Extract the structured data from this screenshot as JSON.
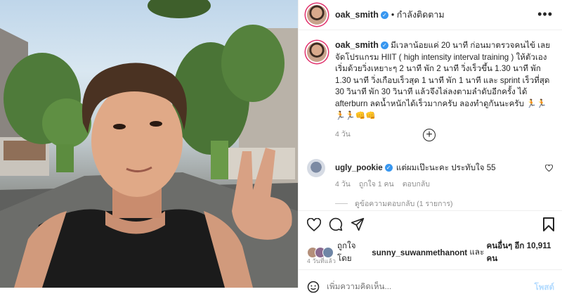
{
  "post": {
    "username": "oak_smith",
    "follow_state": "• กำลังติดตาม",
    "caption": "มีเวลาน้อยแค่ 20 นาที ก่อนมาตรวจคนไข้ เลยจัดโปรแกรม HIIT ( high intensity interval training ) ให้ตัวเอง เริ่มด้วยวิ่งเหยาะๆ 2 นาที พัก 2 นาที วิ่งเร็วขึ้น 1.30 นาที พัก 1.30 นาที วิ่งเกือบเร็วสุด 1 นาที พัก 1 นาที และ sprint เร็วที่สุด 30 วินาที พัก 30 วินาที แล้วจึงไล่ลงตามลำดับอีกครั้ง ได้ afterburn ลดน้ำหนักได้เร็วมากครับ ลองทำดูกันนะครับ 🏃🏃🏃🏃👊👊",
    "caption_age": "4 วัน"
  },
  "comment": {
    "username": "ugly_pookie",
    "text": "แต่ผมเป๊ะนะคะ ประทับใจ 55",
    "age": "4 วัน",
    "likes": "ถูกใจ 1 คน",
    "reply_label": "ตอบกลับ",
    "view_replies": "ดูข้อความตอบกลับ (1 รายการ)"
  },
  "likes": {
    "prefix": "ถูกใจโดย",
    "user": "sunny_suwanmethanont",
    "and": "และ",
    "others": "คนอื่นๆ อีก 10,911 คน"
  },
  "time_ago": "4 วันที่แล้ว",
  "comment_box": {
    "placeholder": "เพิ่มความคิดเห็น...",
    "post_label": "โพสต์"
  },
  "icons": {
    "verified": "verified-badge-icon",
    "more": "more-options-icon",
    "heart": "heart-icon",
    "comment": "comment-icon",
    "share": "share-icon",
    "save": "bookmark-icon",
    "emoji": "emoji-icon",
    "load_more": "plus-circle-icon"
  },
  "colors": {
    "verified": "#3897f0",
    "story_ring": "#e1306c",
    "post_link": "#0095f6"
  }
}
